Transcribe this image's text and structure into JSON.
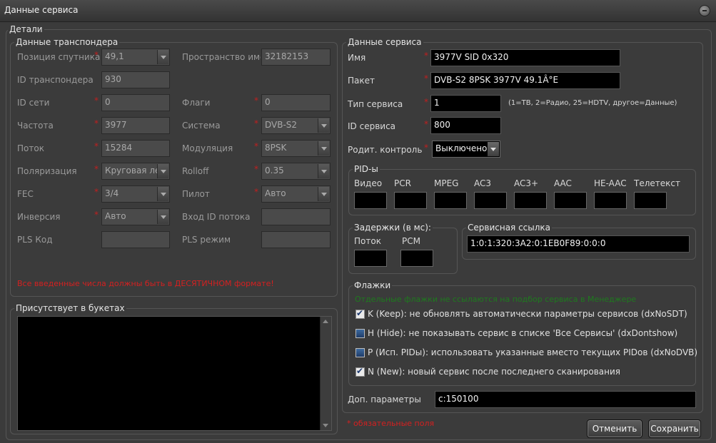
{
  "window": {
    "title": "Данные сервиса"
  },
  "details": {
    "legend": "Детали"
  },
  "transponder": {
    "legend": "Данные транспондера",
    "satellite_position": {
      "label": "Позиция спутника",
      "value": "49,1"
    },
    "namespace": {
      "label": "Пространство имен",
      "value": "32182153"
    },
    "transponder_id": {
      "label": "ID транспондера",
      "value": "930"
    },
    "network_id": {
      "label": "ID сети",
      "value": "0"
    },
    "flags": {
      "label": "Флаги",
      "value": "0"
    },
    "frequency": {
      "label": "Частота",
      "value": "3977"
    },
    "system": {
      "label": "Система",
      "value": "DVB-S2"
    },
    "symbol_rate": {
      "label": "Поток",
      "value": "15284"
    },
    "modulation": {
      "label": "Модуляция",
      "value": "8PSK"
    },
    "polarization": {
      "label": "Поляризация",
      "value": "Круговая лев"
    },
    "rolloff": {
      "label": "Rolloff",
      "value": "0.35"
    },
    "fec": {
      "label": "FEC",
      "value": "3/4"
    },
    "pilot": {
      "label": "Пилот",
      "value": "Авто"
    },
    "inversion": {
      "label": "Инверсия",
      "value": "Авто"
    },
    "stream_id": {
      "label": "Вход ID потока",
      "value": ""
    },
    "pls_code": {
      "label": "PLS Код",
      "value": ""
    },
    "pls_mode": {
      "label": "PLS режим",
      "value": ""
    },
    "error": "Все введенные числа должны быть в ДЕСЯТИЧНОМ формате!"
  },
  "bouquets": {
    "legend": "Присутствует в букетах"
  },
  "service": {
    "legend": "Данные сервиса",
    "name": {
      "label": "Имя",
      "value": "3977V SID 0x320"
    },
    "package": {
      "label": "Пакет",
      "value": "DVB-S2 8PSK 3977V 49.1Â°E"
    },
    "service_type": {
      "label": "Тип сервиса",
      "value": "1",
      "hint": "(1=ТВ, 2=Радио, 25=HDTV, другое=Данные)"
    },
    "service_id": {
      "label": "ID сервиса",
      "value": "800"
    },
    "parental": {
      "label": "Родит. контроль",
      "value": "Выключено"
    }
  },
  "pids": {
    "legend": "PID-ы",
    "labels": [
      "Видео",
      "PCR",
      "MPEG",
      "AC3",
      "AC3+",
      "AAC",
      "HE-AAC",
      "Телетекст"
    ]
  },
  "delays": {
    "legend": "Задержки (в мс):",
    "stream": "Поток",
    "pcm": "PCM"
  },
  "service_ref": {
    "legend": "Сервисная ссылка",
    "value": "1:0:1:320:3A2:0:1EB0F89:0:0:0"
  },
  "flags_section": {
    "legend": "Флажки",
    "hint": "Отдельные флажки не ссылаются на подбор сервиса в Менеджере",
    "items": [
      {
        "label": "K (Keep): не обновлять автоматически параметры сервисов (dxNoSDT)",
        "checked": true
      },
      {
        "label": "H (Hide): не показывать сервис в списке 'Все Сервисы' (dxDontshow)",
        "checked": false
      },
      {
        "label": "P (Исп. PIDы): использовать указанные вместо текущих PIDов (dxNoDVB)",
        "checked": false
      },
      {
        "label": "N (New): новый сервис после последнего сканирования",
        "checked": true
      }
    ]
  },
  "extra": {
    "label": "Доп. параметры",
    "value": "c:150100"
  },
  "footer": {
    "required_note": "* обязательные поля",
    "cancel": "Отменить",
    "save": "Сохранить"
  }
}
